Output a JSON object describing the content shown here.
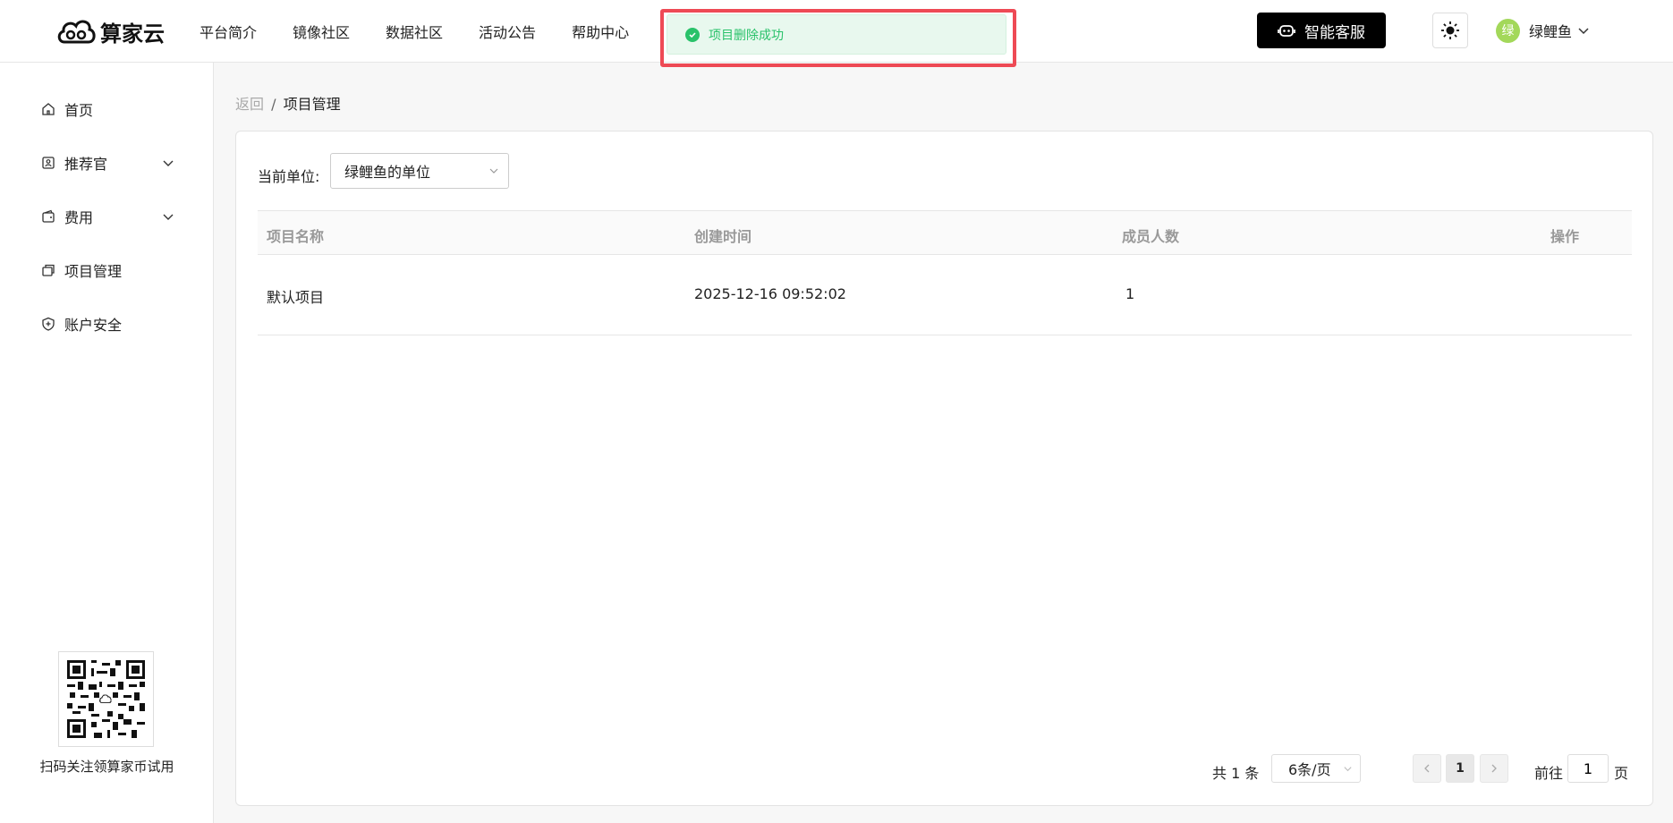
{
  "header": {
    "logo_text": "算家云",
    "nav": [
      "平台简介",
      "镜像社区",
      "数据社区",
      "活动公告",
      "帮助中心"
    ],
    "toast": "项目删除成功",
    "service_label": "智能客服",
    "user": {
      "avatar_char": "绿",
      "name": "绿鲤鱼"
    }
  },
  "sidebar": {
    "items": [
      {
        "label": "首页",
        "icon": "home-icon"
      },
      {
        "label": "推荐官",
        "icon": "badge-icon",
        "expandable": true
      },
      {
        "label": "费用",
        "icon": "wallet-icon",
        "expandable": true
      },
      {
        "label": "项目管理",
        "icon": "projects-icon"
      },
      {
        "label": "账户安全",
        "icon": "shield-icon"
      }
    ],
    "qr_caption": "扫码关注领算家币试用"
  },
  "breadcrumb": {
    "back": "返回",
    "sep": "/",
    "current": "项目管理"
  },
  "filter": {
    "label": "当前单位:",
    "value": "绿鲤鱼的单位"
  },
  "table": {
    "headers": [
      "项目名称",
      "创建时间",
      "成员人数",
      "操作"
    ],
    "rows": [
      [
        "默认项目",
        "2025-12-16 09:52:02",
        "1",
        ""
      ]
    ]
  },
  "pagination": {
    "total": "共 1 条",
    "page_size": "6条/页",
    "current_page": "1",
    "goto_label": "前往",
    "goto_value": "1",
    "goto_suffix": "页"
  },
  "colors": {
    "accent_green": "#29c26a",
    "highlight_red": "#ee4a55",
    "avatar_green": "#a3d85a"
  }
}
